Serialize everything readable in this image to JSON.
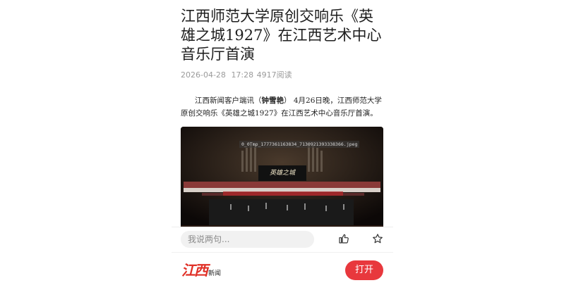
{
  "article": {
    "title": "江西师范大学原创交响乐《英雄之城1927》在江西艺术中心音乐厅首演",
    "date": "2026-04-28",
    "time": "17:28",
    "views": "4917阅读",
    "para_prefix": "江西新闻客户端讯（",
    "para_author": "钟雪艳",
    "para_rest": "） 4月26日晚，江西师范大学原创交响乐《英雄之城1927》在江西艺术中心音乐厅首演。",
    "photo_filename": "0_0Tmp_1777361163834_7130921393338366.jpeg",
    "photo_screen_title": "英雄之城"
  },
  "bottom_bar": {
    "comment_placeholder": "我说两句...",
    "like_icon": "thumbs-up-icon",
    "favorite_icon": "star-icon"
  },
  "app_banner": {
    "logo_text": "江西",
    "logo_sub": "新闻",
    "open_label": "打开",
    "accent": "#e8383d"
  }
}
